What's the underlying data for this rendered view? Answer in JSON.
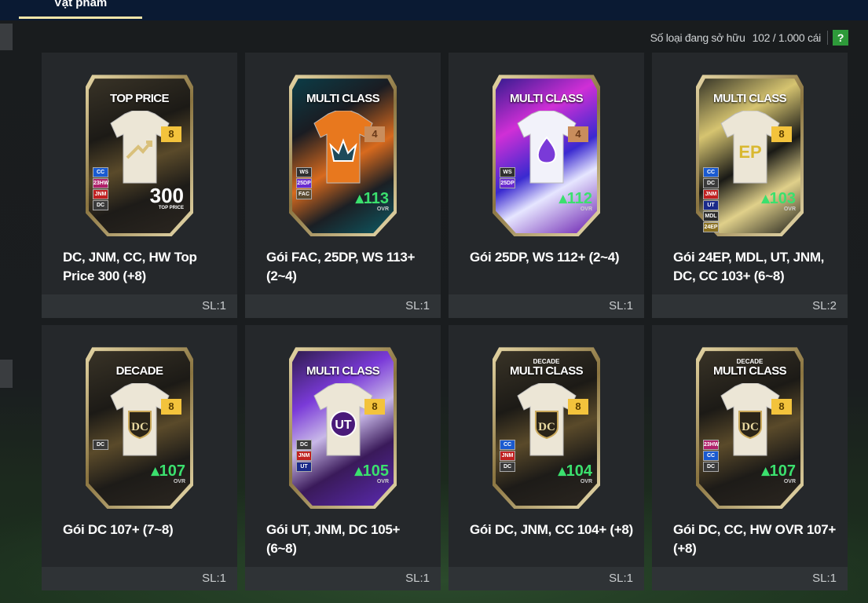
{
  "header": {
    "tab_label": "Vật phẩm"
  },
  "owned": {
    "label": "Số loại đang sở hữu",
    "count": "102 / 1.000 cái",
    "help_label": "?"
  },
  "packs": [
    {
      "title": "DC, JNM, CC, HW Top Price 300 (+8)",
      "qty": "SL:1",
      "pack_label": "TOP PRICE",
      "pack_sub": "",
      "big_value": "300",
      "big_caption": "TOP PRICE",
      "ovr": "",
      "ovr_caption": "",
      "level": "8",
      "tags": [
        "CC",
        "23HW",
        "JNM",
        "DC"
      ],
      "theme": "gold-dark",
      "emblem": "chart"
    },
    {
      "title": "Gói FAC, 25DP, WS 113+ (2~4)",
      "qty": "SL:1",
      "pack_label": "MULTI CLASS",
      "pack_sub": "",
      "big_value": "",
      "big_caption": "",
      "ovr": "113",
      "ovr_caption": "OVR",
      "level": "4",
      "tags": [
        "WS",
        "25DP",
        "FAC"
      ],
      "theme": "orange-teal",
      "emblem": "crown"
    },
    {
      "title": "Gói 25DP, WS 112+ (2~4)",
      "qty": "SL:1",
      "pack_label": "MULTI CLASS",
      "pack_sub": "",
      "big_value": "",
      "big_caption": "",
      "ovr": "112",
      "ovr_caption": "OVR",
      "level": "4",
      "tags": [
        "WS",
        "25DP"
      ],
      "theme": "purple",
      "emblem": "flame"
    },
    {
      "title": "Gói 24EP, MDL, UT, JNM, DC, CC 103+ (6~8)",
      "qty": "SL:2",
      "pack_label": "MULTI CLASS",
      "pack_sub": "",
      "big_value": "",
      "big_caption": "",
      "ovr": "103",
      "ovr_caption": "OVR",
      "level": "8",
      "tags": [
        "CC",
        "DC",
        "JNM",
        "UT",
        "MDL",
        "24EP"
      ],
      "theme": "gold-black",
      "emblem": "ep"
    },
    {
      "title": "Gói DC 107+ (7~8)",
      "qty": "SL:1",
      "pack_label": "DECADE",
      "pack_sub": "",
      "big_value": "",
      "big_caption": "",
      "ovr": "107",
      "ovr_caption": "OVR",
      "level": "8",
      "tags": [
        "DC"
      ],
      "theme": "gold-dark",
      "emblem": "dc"
    },
    {
      "title": "Gói UT, JNM, DC 105+ (6~8)",
      "qty": "SL:1",
      "pack_label": "MULTI CLASS",
      "pack_sub": "",
      "big_value": "",
      "big_caption": "",
      "ovr": "105",
      "ovr_caption": "OVR",
      "level": "8",
      "tags": [
        "DC",
        "JNM",
        "UT"
      ],
      "theme": "violet",
      "emblem": "ut"
    },
    {
      "title": "Gói DC, JNM, CC 104+ (+8)",
      "qty": "SL:1",
      "pack_label": "MULTI CLASS",
      "pack_sub": "DECADE",
      "big_value": "",
      "big_caption": "",
      "ovr": "104",
      "ovr_caption": "OVR",
      "level": "8",
      "tags": [
        "CC",
        "JNM",
        "DC"
      ],
      "theme": "gold-dark",
      "emblem": "dc"
    },
    {
      "title": "Gói DC, CC, HW OVR 107+ (+8)",
      "qty": "SL:1",
      "pack_label": "MULTI CLASS",
      "pack_sub": "DECADE",
      "big_value": "",
      "big_caption": "",
      "ovr": "107",
      "ovr_caption": "OVR",
      "level": "8",
      "tags": [
        "23HW",
        "CC",
        "DC"
      ],
      "theme": "gold-dark",
      "emblem": "dc"
    }
  ]
}
